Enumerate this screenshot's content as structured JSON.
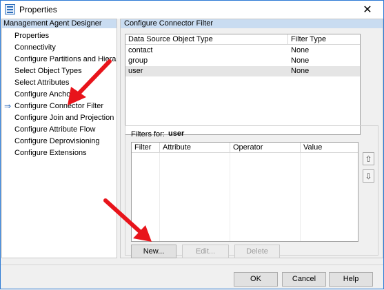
{
  "window": {
    "title": "Properties"
  },
  "left": {
    "header": "Management Agent Designer",
    "items": [
      {
        "label": "Properties",
        "selected": false
      },
      {
        "label": "Connectivity",
        "selected": false
      },
      {
        "label": "Configure Partitions and Hierarchies",
        "selected": false
      },
      {
        "label": "Select Object Types",
        "selected": false
      },
      {
        "label": "Select Attributes",
        "selected": false
      },
      {
        "label": "Configure Anchors",
        "selected": false
      },
      {
        "label": "Configure Connector Filter",
        "selected": true
      },
      {
        "label": "Configure Join and Projection Rules",
        "selected": false
      },
      {
        "label": "Configure Attribute Flow",
        "selected": false
      },
      {
        "label": "Configure Deprovisioning",
        "selected": false
      },
      {
        "label": "Configure Extensions",
        "selected": false
      }
    ]
  },
  "right": {
    "header": "Configure Connector Filter",
    "types_table": {
      "columns": [
        "Data Source Object Type",
        "Filter Type"
      ],
      "rows": [
        [
          "contact",
          "None"
        ],
        [
          "group",
          "None"
        ],
        [
          "user",
          "None"
        ]
      ],
      "selected_row": 2
    },
    "filters": {
      "label": "Filters for:",
      "value": "user",
      "columns": [
        "Filter",
        "Attribute",
        "Operator",
        "Value"
      ],
      "buttons": {
        "new": "New...",
        "edit": "Edit...",
        "delete": "Delete"
      },
      "move_up": "⇧",
      "move_down": "⇩"
    }
  },
  "dialog_buttons": {
    "ok": "OK",
    "cancel": "Cancel",
    "help": "Help"
  },
  "colors": {
    "header_bg": "#c9dcf1",
    "selected_row": "#e5e5e5",
    "arrow": "#e8141b",
    "nav_arrow": "#1f5fb4"
  },
  "icons": {
    "close": "✕"
  }
}
